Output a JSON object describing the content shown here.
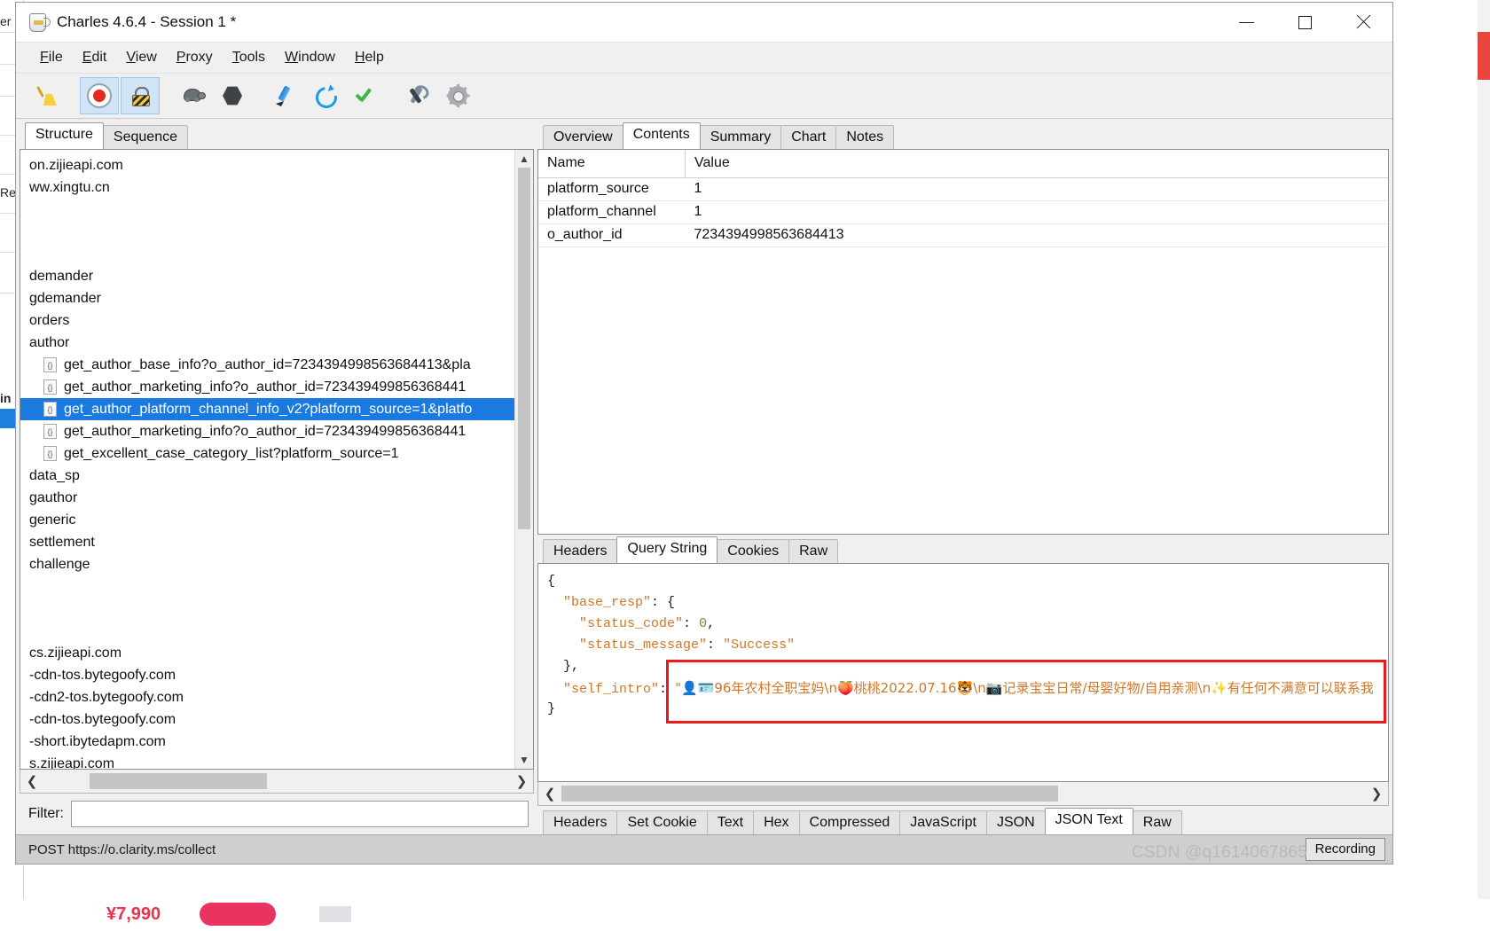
{
  "window": {
    "title": "Charles 4.6.4 - Session 1 *",
    "app_icon": "jug-icon",
    "minimize_label": "Minimize",
    "maximize_label": "Maximize",
    "close_label": "Close"
  },
  "menubar": {
    "items": [
      {
        "mnemonic": "F",
        "rest": "ile"
      },
      {
        "mnemonic": "E",
        "rest": "dit"
      },
      {
        "mnemonic": "V",
        "rest": "iew"
      },
      {
        "mnemonic": "P",
        "rest": "roxy"
      },
      {
        "mnemonic": "T",
        "rest": "ools"
      },
      {
        "mnemonic": "W",
        "rest": "indow"
      },
      {
        "mnemonic": "H",
        "rest": "elp"
      }
    ]
  },
  "toolbar": {
    "buttons": [
      {
        "icon": "broom-icon",
        "label": "Clear Session",
        "active": false
      },
      {
        "icon": "record-icon",
        "label": "Start/Stop Recording",
        "active": true
      },
      {
        "icon": "lock-icon",
        "label": "SSL Proxying",
        "active": true
      },
      {
        "icon": "turtle-icon",
        "label": "Throttling",
        "active": false
      },
      {
        "icon": "breakpoint-icon",
        "label": "Breakpoints",
        "active": false
      },
      {
        "icon": "compose-icon",
        "label": "Compose",
        "active": false
      },
      {
        "icon": "repeat-icon",
        "label": "Repeat",
        "active": false
      },
      {
        "icon": "validate-icon",
        "label": "Validate",
        "active": false
      },
      {
        "icon": "tools-icon",
        "label": "Tools",
        "active": false
      },
      {
        "icon": "gear-icon",
        "label": "Settings",
        "active": false
      }
    ]
  },
  "left_pane": {
    "tabs": [
      {
        "label": "Structure",
        "selected": true
      },
      {
        "label": "Sequence",
        "selected": false
      }
    ],
    "tree": [
      {
        "text": "on.zijieapi.com",
        "type": "host",
        "selected": false
      },
      {
        "text": "ww.xingtu.cn",
        "type": "host",
        "selected": false
      },
      {
        "text": "",
        "type": "blank",
        "selected": false
      },
      {
        "text": "",
        "type": "blank",
        "selected": false
      },
      {
        "text": "",
        "type": "blank",
        "selected": false
      },
      {
        "text": "demander",
        "type": "folder",
        "selected": false
      },
      {
        "text": "gdemander",
        "type": "folder",
        "selected": false
      },
      {
        "text": "orders",
        "type": "folder",
        "selected": false
      },
      {
        "text": "author",
        "type": "folder",
        "selected": false
      },
      {
        "text": "get_author_base_info?o_author_id=7234394998563684413&pla",
        "type": "request",
        "selected": false
      },
      {
        "text": "get_author_marketing_info?o_author_id=723439499856368441",
        "type": "request",
        "selected": false
      },
      {
        "text": "get_author_platform_channel_info_v2?platform_source=1&platfo",
        "type": "request",
        "selected": true
      },
      {
        "text": "get_author_marketing_info?o_author_id=723439499856368441",
        "type": "request",
        "selected": false
      },
      {
        "text": "get_excellent_case_category_list?platform_source=1",
        "type": "request",
        "selected": false
      },
      {
        "text": "data_sp",
        "type": "folder",
        "selected": false
      },
      {
        "text": "gauthor",
        "type": "folder",
        "selected": false
      },
      {
        "text": "generic",
        "type": "folder",
        "selected": false
      },
      {
        "text": "settlement",
        "type": "folder",
        "selected": false
      },
      {
        "text": "challenge",
        "type": "folder",
        "selected": false
      },
      {
        "text": "",
        "type": "blank",
        "selected": false
      },
      {
        "text": "",
        "type": "blank",
        "selected": false
      },
      {
        "text": "",
        "type": "blank",
        "selected": false
      },
      {
        "text": "cs.zijieapi.com",
        "type": "host",
        "selected": false
      },
      {
        "text": "-cdn-tos.bytegoofy.com",
        "type": "host",
        "selected": false
      },
      {
        "text": "-cdn2-tos.bytegoofy.com",
        "type": "host",
        "selected": false
      },
      {
        "text": "-cdn-tos.bytegoofy.com",
        "type": "host",
        "selected": false
      },
      {
        "text": "-short.ibytedapm.com",
        "type": "host",
        "selected": false
      },
      {
        "text": "s.zijieapi.com",
        "type": "host",
        "selected": false
      }
    ],
    "filter": {
      "label": "Filter:",
      "value": "",
      "placeholder": ""
    }
  },
  "right_pane": {
    "top_tabs": [
      {
        "label": "Overview",
        "selected": false
      },
      {
        "label": "Contents",
        "selected": true
      },
      {
        "label": "Summary",
        "selected": false
      },
      {
        "label": "Chart",
        "selected": false
      },
      {
        "label": "Notes",
        "selected": false
      }
    ],
    "query_table": {
      "headers": [
        "Name",
        "Value"
      ],
      "rows": [
        [
          "platform_source",
          "1"
        ],
        [
          "platform_channel",
          "1"
        ],
        [
          "o_author_id",
          "7234394998563684413"
        ]
      ]
    },
    "request_tabs": [
      {
        "label": "Headers",
        "selected": false
      },
      {
        "label": "Query String",
        "selected": true
      },
      {
        "label": "Cookies",
        "selected": false
      },
      {
        "label": "Raw",
        "selected": false
      }
    ],
    "response_tabs": [
      {
        "label": "Headers",
        "selected": false
      },
      {
        "label": "Set Cookie",
        "selected": false
      },
      {
        "label": "Text",
        "selected": false
      },
      {
        "label": "Hex",
        "selected": false
      },
      {
        "label": "Compressed",
        "selected": false
      },
      {
        "label": "JavaScript",
        "selected": false
      },
      {
        "label": "JSON",
        "selected": false
      },
      {
        "label": "JSON Text",
        "selected": true
      },
      {
        "label": "Raw",
        "selected": false
      }
    ],
    "json_body": {
      "lines": [
        {
          "indent": 0,
          "parts": [
            {
              "t": "{",
              "c": "p"
            }
          ]
        },
        {
          "indent": 1,
          "parts": [
            {
              "t": "\"base_resp\"",
              "c": "k"
            },
            {
              "t": ": {",
              "c": "p"
            }
          ]
        },
        {
          "indent": 2,
          "parts": [
            {
              "t": "\"status_code\"",
              "c": "k"
            },
            {
              "t": ": ",
              "c": "p"
            },
            {
              "t": "0",
              "c": "num"
            },
            {
              "t": ",",
              "c": "p"
            }
          ]
        },
        {
          "indent": 2,
          "parts": [
            {
              "t": "\"status_message\"",
              "c": "k"
            },
            {
              "t": ": ",
              "c": "p"
            },
            {
              "t": "\"Success\"",
              "c": "s"
            }
          ]
        },
        {
          "indent": 1,
          "parts": [
            {
              "t": "},",
              "c": "p"
            }
          ]
        },
        {
          "indent": 1,
          "parts": [
            {
              "t": "\"self_intro\"",
              "c": "k"
            },
            {
              "t": ": ",
              "c": "p"
            },
            {
              "t": "\"👤🪪96年农村全职宝妈\\n🍑桃桃2022.07.16🐯\\n📷记录宝宝日常/母婴好物/自用亲测\\n✨有任何不满意可以联系我",
              "c": "s"
            }
          ]
        },
        {
          "indent": 0,
          "parts": [
            {
              "t": "}",
              "c": "p"
            }
          ]
        }
      ],
      "highlight_note": "red-annotation-box-around-self-intro-value"
    }
  },
  "status_bar": {
    "request_text": "POST https://o.clarity.ms/collect",
    "recording_label": "Recording",
    "watermark": "CSDN @q1614067865"
  },
  "colors": {
    "selection_blue": "#1a7ae0",
    "annotation_red": "#ef1b1b",
    "json_key_orange": "#cf7728",
    "json_number_green": "#6a8f2f",
    "status_bar_gray": "#cfcfcf",
    "toolbar_active": "#cfe4f7"
  },
  "background": {
    "left_words": [
      "er",
      "Re",
      "in"
    ],
    "price": "¥7,990"
  }
}
